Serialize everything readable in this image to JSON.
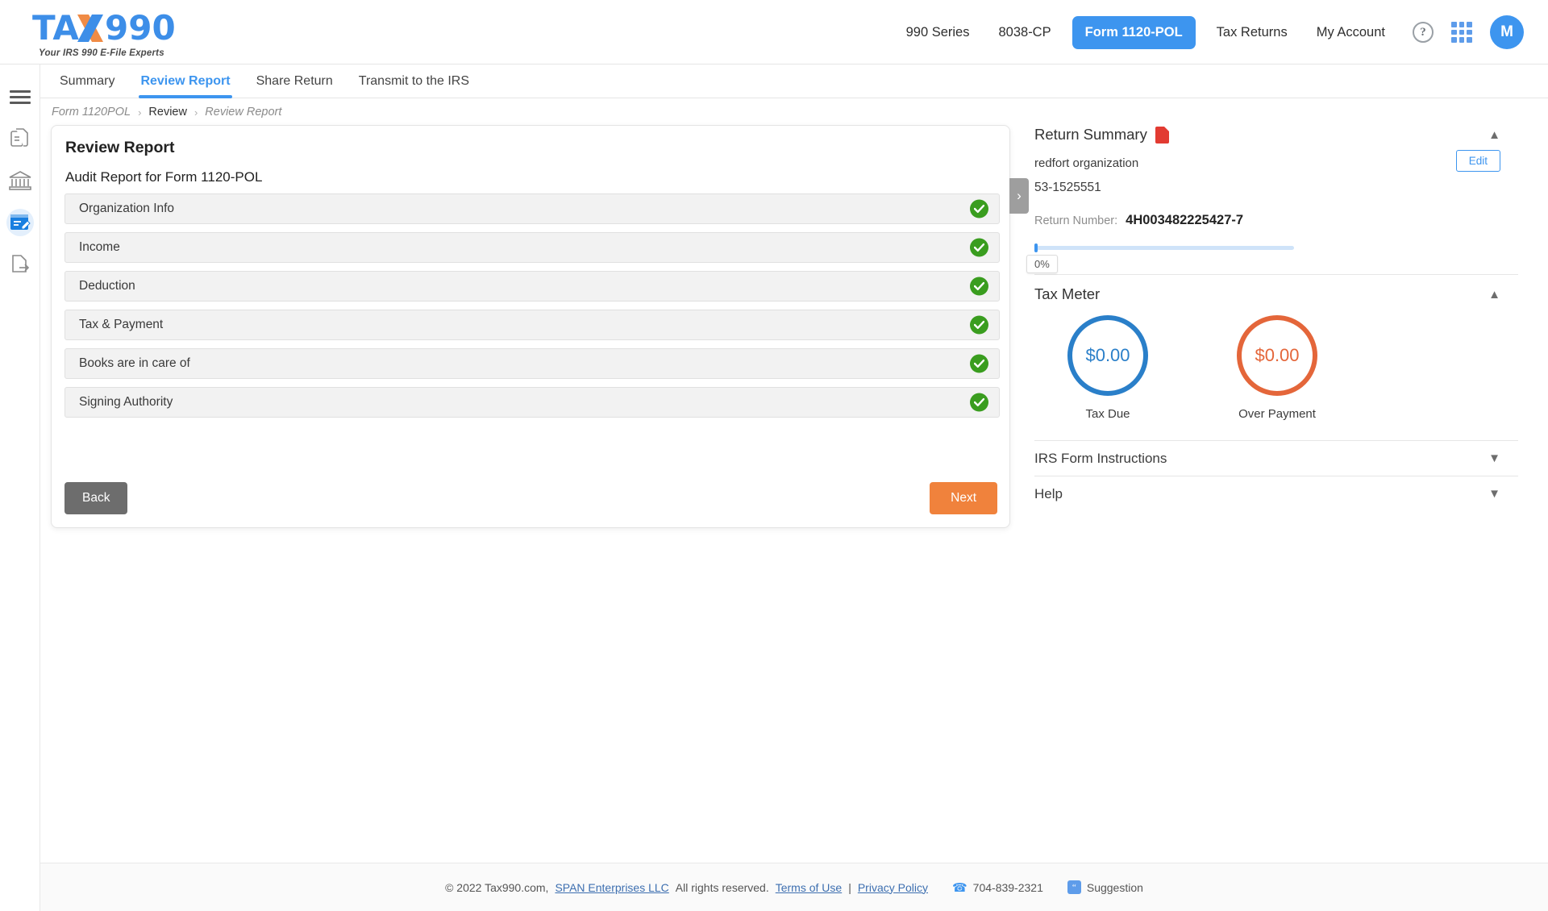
{
  "brand": {
    "name": "TAX990",
    "tagline": "Your IRS 990 E-File Experts",
    "accent_blue": "#3d95ef",
    "accent_orange": "#f0823c"
  },
  "header": {
    "nav": [
      {
        "label": "990 Series",
        "active": false
      },
      {
        "label": "8038-CP",
        "active": false
      },
      {
        "label": "Form 1120-POL",
        "active": true
      },
      {
        "label": "Tax Returns",
        "active": false
      },
      {
        "label": "My Account",
        "active": false
      }
    ],
    "help_icon": "help-question-icon",
    "apps_icon": "app-grid-icon",
    "avatar_initial": "M"
  },
  "sidebar_rail": {
    "items": [
      {
        "icon": "hamburger-menu-icon",
        "active": false
      },
      {
        "icon": "documents-icon",
        "active": false
      },
      {
        "icon": "bank-institution-icon",
        "active": false
      },
      {
        "icon": "form-edit-icon",
        "active": true
      },
      {
        "icon": "document-export-icon",
        "active": false
      }
    ]
  },
  "tabs": [
    {
      "label": "Summary",
      "active": false
    },
    {
      "label": "Review Report",
      "active": true
    },
    {
      "label": "Share Return",
      "active": false
    },
    {
      "label": "Transmit to the IRS",
      "active": false
    }
  ],
  "breadcrumb": {
    "item1": "Form 1120POL",
    "item2": "Review",
    "item3": "Review Report",
    "separator": "›"
  },
  "main": {
    "title": "Review Report",
    "subtitle": "Audit Report for Form 1120-POL",
    "rows": [
      {
        "label": "Organization Info",
        "status": "complete"
      },
      {
        "label": "Income",
        "status": "complete"
      },
      {
        "label": "Deduction",
        "status": "complete"
      },
      {
        "label": "Tax & Payment",
        "status": "complete"
      },
      {
        "label": "Books are in care of",
        "status": "complete"
      },
      {
        "label": "Signing Authority",
        "status": "complete"
      }
    ],
    "back_label": "Back",
    "next_label": "Next",
    "collapse_icon": "chevron-right-icon",
    "check_color": "#3a9d1f"
  },
  "right_panel": {
    "return_summary": {
      "title": "Return Summary",
      "pdf_icon": "pdf-download-icon",
      "collapse_icon": "chevron-up-icon",
      "org_name": "redfort organization",
      "ein": "53-1525551",
      "edit_label": "Edit",
      "return_number_label": "Return Number:",
      "return_number": "4H003482225427-7",
      "progress_percent": "0%"
    },
    "tax_meter": {
      "title": "Tax Meter",
      "collapse_icon": "chevron-up-icon",
      "gauges": [
        {
          "value": "$0.00",
          "caption": "Tax Due",
          "color": "#2a7fc9"
        },
        {
          "value": "$0.00",
          "caption": "Over Payment",
          "color": "#e4663a"
        }
      ]
    },
    "sections": [
      {
        "label": "IRS Form Instructions",
        "icon": "chevron-down-icon"
      },
      {
        "label": "Help",
        "icon": "chevron-down-icon"
      }
    ]
  },
  "footer": {
    "copyright": "© 2022 Tax990.com,",
    "company_link": "SPAN Enterprises LLC",
    "rights": "All rights reserved.",
    "terms_link": "Terms of Use",
    "pipe": "|",
    "privacy_link": "Privacy Policy",
    "phone_icon": "phone-icon",
    "phone": "704-839-2321",
    "suggestion_icon": "quote-suggestion-icon",
    "suggestion": "Suggestion"
  }
}
